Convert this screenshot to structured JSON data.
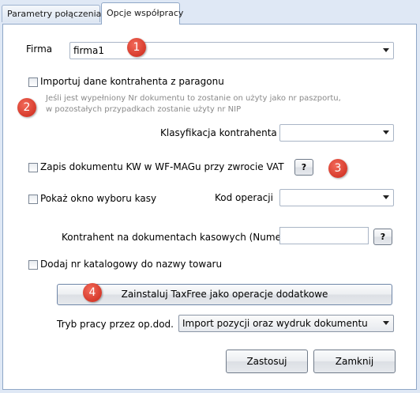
{
  "tabs": [
    {
      "label": "Parametry połączenia"
    },
    {
      "label": "Opcje współpracy"
    }
  ],
  "firma": {
    "label": "Firma",
    "value": "firma1"
  },
  "import_checkbox": {
    "label": "Importuj dane kontrahenta z paragonu",
    "checked": false
  },
  "hint": {
    "line1": "Jeśli jest wypełniony Nr dokumentu to zostanie on użyty jako nr paszportu,",
    "line2": "w pozostałych przypadkach zostanie użyty nr NIP"
  },
  "klasyfikacja": {
    "label": "Klasyfikacja kontrahenta",
    "value": ""
  },
  "zapis_checkbox": {
    "label": "Zapis dokumentu KW w WF-MAGu przy zwrocie VAT",
    "checked": false
  },
  "help_button": {
    "label": "?"
  },
  "pokaz_checkbox": {
    "label": "Pokaż okno wyboru kasy",
    "checked": false
  },
  "kod_operacji": {
    "label": "Kod operacji",
    "value": ""
  },
  "kontrahent": {
    "label": "Kontrahent na dokumentach kasowych (Numer)",
    "value": ""
  },
  "dodaj_checkbox": {
    "label": "Dodaj nr katalogowy do nazwy towaru",
    "checked": false
  },
  "install_button": {
    "label": "Zainstaluj TaxFree jako operacje dodatkowe"
  },
  "tryb": {
    "label": "Tryb pracy przez op.dod.",
    "value": "Import pozycji oraz wydruk dokumentu"
  },
  "footer": {
    "apply_label": "Zastosuj",
    "close_label": "Zamknij"
  },
  "badges": [
    "1",
    "2",
    "3",
    "4"
  ],
  "colors": {
    "background": "#dfe8f5",
    "badge": "#d63a2b",
    "hint_text": "#8a8a8a"
  }
}
